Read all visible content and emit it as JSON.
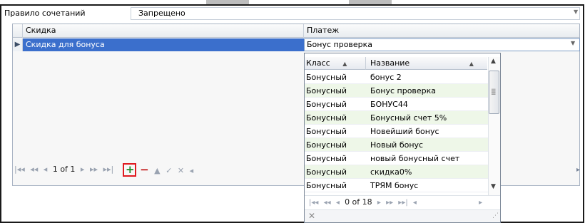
{
  "rule": {
    "label": "Правило сочетаний",
    "value": "Запрещено"
  },
  "grid": {
    "columns": [
      "Скидка",
      "Платеж"
    ],
    "row": {
      "discount": "Скидка для бонуса",
      "payment": "Бонус проверка"
    },
    "navigator": {
      "page_text": "1 of 1"
    }
  },
  "popup": {
    "columns": [
      "Класс",
      "Название"
    ],
    "rows": [
      {
        "class": "Бонусный",
        "name": "бонус 2"
      },
      {
        "class": "Бонусный",
        "name": "Бонус проверка"
      },
      {
        "class": "Бонусный",
        "name": "БОНУС44"
      },
      {
        "class": "Бонусный",
        "name": "Бонусный счет 5%"
      },
      {
        "class": "Бонусный",
        "name": "Новейший бонус"
      },
      {
        "class": "Бонусный",
        "name": "Новый бонус"
      },
      {
        "class": "Бонусный",
        "name": "новый бонусный счет"
      },
      {
        "class": "Бонусный",
        "name": "скидка0%"
      },
      {
        "class": "Бонусный",
        "name": "ТРЯМ бонус"
      }
    ],
    "navigator": {
      "page_text": "0 of 18"
    }
  },
  "colors": {
    "selection": "#3b6fcc",
    "alt_row": "#eef7e8",
    "highlight_box": "#e0191f",
    "add_icon": "#1c8a25",
    "remove_icon": "#c11a1a"
  }
}
